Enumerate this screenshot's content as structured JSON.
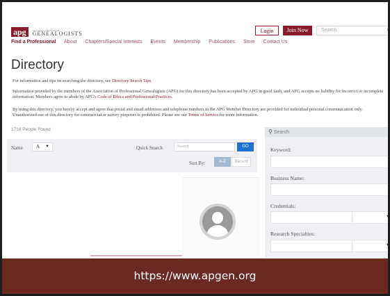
{
  "header": {
    "logo_mark": "apg",
    "logo_small": "Association of Professional",
    "logo_big": "GENEALOGISTS",
    "login": "Login",
    "join": "Join Now",
    "search_placeholder": "Search",
    "search_icon_glyph": "G"
  },
  "nav": [
    "Find a Professional",
    "About",
    "Chapters/Special Interests",
    "Events",
    "Membership",
    "Publications",
    "Store",
    "Contact Us"
  ],
  "directory": {
    "title": "Directory",
    "p1_a": "For information and tips on searching the directory, see ",
    "p1_link": "Directory Search Tips",
    "p1_b": ".",
    "p2_a": "Information provided by the members of the Association of Professional Genealogists (APG) for this directory has been accepted by APG in good faith, and APG accepts no liability for incorrect or incomplete information. Members agree to abide by APG's ",
    "p2_link": "Code of Ethics and Professional Practices",
    "p2_b": ".",
    "p3_a": "By using this directory, you hereby accept and agree that postal and email addresses and telephone numbers in the APG Member Directory are provided for individual personal communication only. Unauthorized use of this directory for commercial or survey purposes is prohibited. Please see our ",
    "p3_link": "Terms of Service",
    "p3_b": " for more information."
  },
  "results": {
    "count": "1716 People Found",
    "name_label": "Name",
    "name_value": "A",
    "quick_search_label": "Quick Search",
    "quick_search_placeholder": "Search",
    "go": "GO",
    "sort_label": "Sort By:",
    "sort_az": "A-Z",
    "sort_recent": "Recent"
  },
  "search_panel": {
    "header": "Search",
    "keyword": "Keyword:",
    "business_name": "Business Name:",
    "credentials": "Credentials:",
    "research_specialties": "Research Specialties:"
  },
  "banner": {
    "url": "https://www.apgen.org"
  },
  "colors": {
    "brand": "#8a1b2c",
    "go_button": "#1f6fd1",
    "banner": "#6b2a1f"
  }
}
